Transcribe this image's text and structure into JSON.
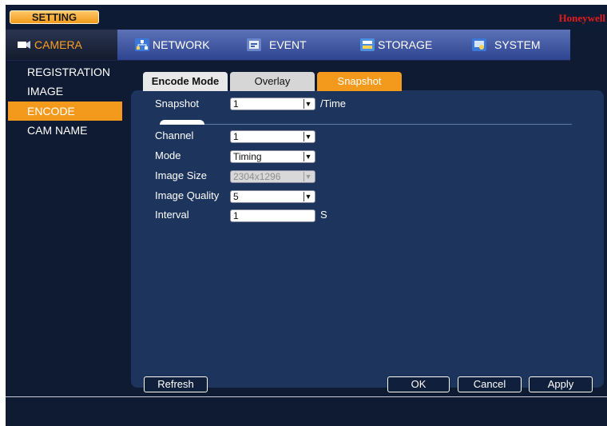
{
  "window": {
    "title": "SETTING",
    "brand": "Honeywell"
  },
  "top_tabs": [
    {
      "label": "CAMERA",
      "icon": "camera-icon",
      "active": true
    },
    {
      "label": "NETWORK",
      "icon": "network-icon"
    },
    {
      "label": "EVENT",
      "icon": "event-icon"
    },
    {
      "label": "STORAGE",
      "icon": "storage-icon"
    },
    {
      "label": "SYSTEM",
      "icon": "system-icon"
    }
  ],
  "sidebar": {
    "items": [
      {
        "label": "REGISTRATION"
      },
      {
        "label": "IMAGE"
      },
      {
        "label": "ENCODE",
        "active": true
      },
      {
        "label": "CAM NAME"
      }
    ]
  },
  "sub_tabs": [
    {
      "label": "Encode Mode"
    },
    {
      "label": "Overlay"
    },
    {
      "label": "Snapshot",
      "active": true
    }
  ],
  "snapshot": {
    "label": "Snapshot",
    "value": "1",
    "suffix": "/Time"
  },
  "form": {
    "channel": {
      "label": "Channel",
      "value": "1"
    },
    "mode": {
      "label": "Mode",
      "value": "Timing"
    },
    "image_size": {
      "label": "Image Size",
      "value": "2304x1296"
    },
    "image_quality": {
      "label": "Image Quality",
      "value": "5"
    },
    "interval": {
      "label": "Interval",
      "value": "1",
      "unit": "S"
    }
  },
  "buttons": {
    "refresh": "Refresh",
    "ok": "OK",
    "cancel": "Cancel",
    "apply": "Apply"
  },
  "colors": {
    "accent": "#f39a1c",
    "panel": "#1d355c",
    "background": "#0f1a33",
    "brand": "#e21c1c"
  }
}
